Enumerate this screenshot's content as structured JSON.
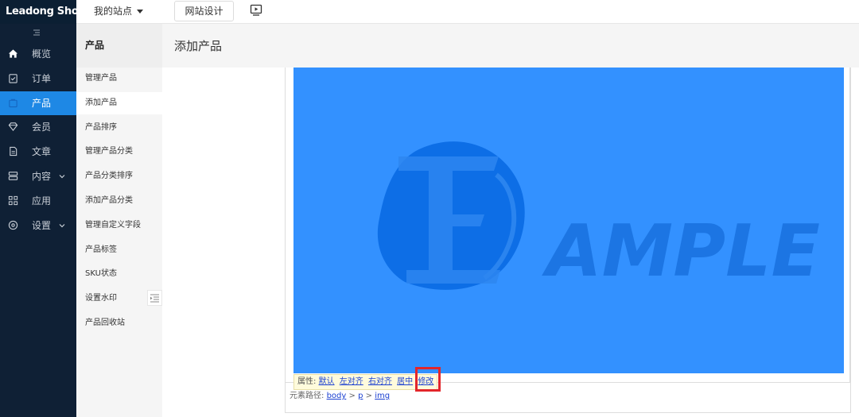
{
  "topbar": {
    "logo": "Leadong Shop",
    "site_menu": "我的站点",
    "design_button": "网站设计",
    "preview_icon": "monitor-play-icon"
  },
  "sidebar": {
    "items": [
      {
        "label": "概览",
        "icon": "home-icon",
        "active": false
      },
      {
        "label": "订单",
        "icon": "clipboard-icon",
        "active": false
      },
      {
        "label": "产品",
        "icon": "bag-icon",
        "active": true
      },
      {
        "label": "会员",
        "icon": "diamond-icon",
        "active": false
      },
      {
        "label": "文章",
        "icon": "document-icon",
        "active": false
      },
      {
        "label": "内容",
        "icon": "content-icon",
        "active": false,
        "expandable": true
      },
      {
        "label": "应用",
        "icon": "apps-icon",
        "active": false
      },
      {
        "label": "设置",
        "icon": "settings-icon",
        "active": false,
        "expandable": true
      }
    ]
  },
  "subnav": {
    "title": "产品",
    "items": [
      {
        "label": "管理产品"
      },
      {
        "label": "添加产品",
        "active": true
      },
      {
        "label": "产品排序"
      },
      {
        "label": "管理产品分类"
      },
      {
        "label": "产品分类排序"
      },
      {
        "label": "添加产品分类"
      },
      {
        "label": "管理自定义字段"
      },
      {
        "label": "产品标签"
      },
      {
        "label": "SKU状态"
      },
      {
        "label": "设置水印"
      },
      {
        "label": "产品回收站"
      }
    ]
  },
  "main": {
    "title": "添加产品",
    "image_text": "AMPLE",
    "attr_bar": {
      "label": "属性:",
      "links": [
        "默认",
        "左对齐",
        "右对齐",
        "居中",
        "修改"
      ]
    },
    "path_bar": {
      "label": "元素路径:",
      "items": [
        "body",
        "p",
        "img"
      ],
      "separator": ">"
    }
  },
  "colors": {
    "sidebar_bg": "#0f2035",
    "active_blue": "#1e88e5",
    "image_bg": "#3391ff",
    "highlight": "#e3262b"
  }
}
